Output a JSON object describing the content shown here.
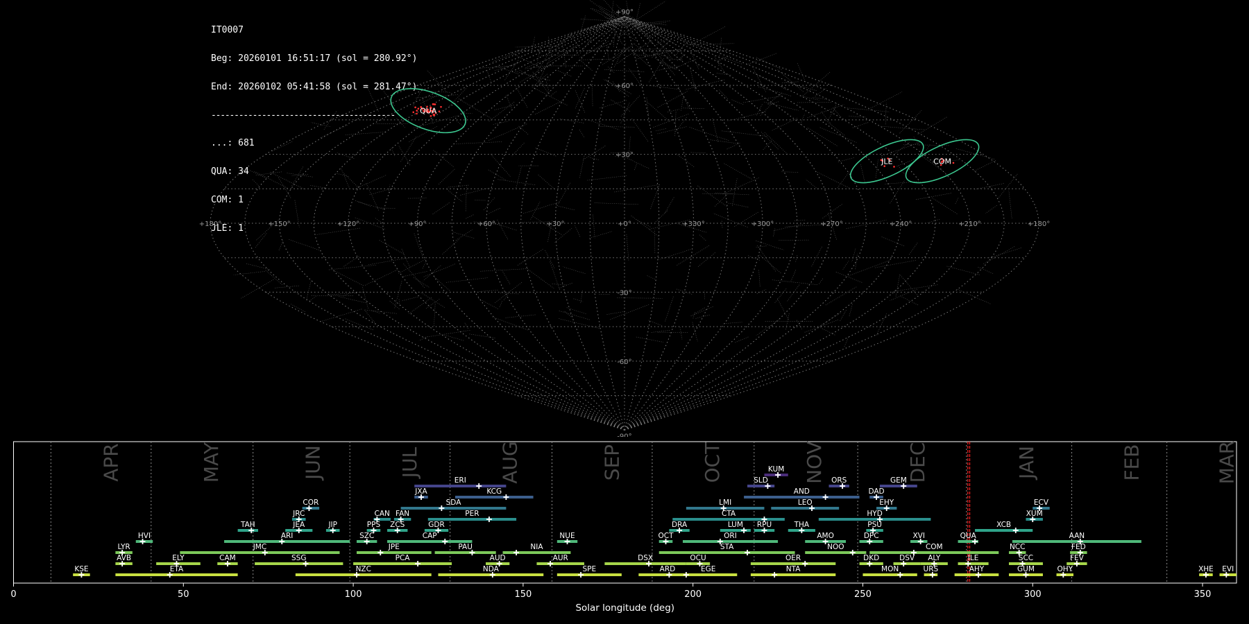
{
  "info": {
    "station": "IT0007",
    "beg": "Beg: 20260101 16:51:17 (sol = 280.92°)",
    "end": "End: 20260102 05:41:58 (sol = 281.47°)",
    "separator": "----------------------------------------",
    "counts": [
      "...: 681",
      "QUA: 34",
      "COM: 1",
      "JLE: 1"
    ]
  },
  "colors": {
    "background": "#000000",
    "grid": "#8a8a8a",
    "meteor_trail": "#6e6e6e",
    "shower_highlight": "#ff3030",
    "radiant_circle": "#3cc890",
    "label": "#ffffff",
    "month": "#4a4a4a"
  },
  "chart_data": [
    {
      "type": "scatter",
      "projection": "sinusoidal",
      "lon_labels": [
        "+180°",
        "+150°",
        "+120°",
        "+90°",
        "+60°",
        "+30°",
        "+0°",
        "+330°",
        "+300°",
        "+270°",
        "+240°",
        "+210°",
        "+180°"
      ],
      "lat_labels": [
        {
          "lat": 90,
          "label": "+90°"
        },
        {
          "lat": 60,
          "label": "+60°"
        },
        {
          "lat": 30,
          "label": "+30°"
        },
        {
          "lat": -30,
          "label": "-30°"
        },
        {
          "lat": -60,
          "label": "-60°"
        },
        {
          "lat": -90,
          "label": "-90°"
        }
      ],
      "radiants": [
        {
          "name": "QUA",
          "lon": 230,
          "lat": 49,
          "radius": 8
        },
        {
          "name": "COM",
          "lon": 155,
          "lat": 27,
          "radius": 6
        },
        {
          "name": "JLE",
          "lon": 128,
          "lat": 27,
          "radius": 6
        }
      ]
    },
    {
      "type": "bar",
      "xlabel": "Solar longitude (deg)",
      "xlim": [
        0,
        360
      ],
      "xticks": [
        0,
        50,
        100,
        150,
        200,
        250,
        300,
        350
      ],
      "current_sol": [
        280.92,
        281.47
      ],
      "months": [
        {
          "name": "APR",
          "start": 11
        },
        {
          "name": "MAY",
          "start": 40.5
        },
        {
          "name": "JUN",
          "start": 70.5
        },
        {
          "name": "JUL",
          "start": 99
        },
        {
          "name": "AUG",
          "start": 128.5
        },
        {
          "name": "SEP",
          "start": 158.5
        },
        {
          "name": "OCT",
          "start": 188
        },
        {
          "name": "NOV",
          "start": 218
        },
        {
          "name": "DEC",
          "start": 248.5
        },
        {
          "name": "JAN",
          "start": 280.5
        },
        {
          "name": "FEB",
          "start": 311.5
        },
        {
          "name": "MAR",
          "start": 339.5
        }
      ],
      "showers": [
        {
          "code": "KSE",
          "start": 17.5,
          "end": 22.5,
          "peak": 20,
          "row": 0
        },
        {
          "code": "ETA",
          "start": 30,
          "end": 66,
          "peak": 46,
          "row": 0
        },
        {
          "code": "NZC",
          "start": 83,
          "end": 123,
          "peak": 101,
          "row": 0
        },
        {
          "code": "NDA",
          "start": 125,
          "end": 156,
          "peak": 141,
          "row": 0
        },
        {
          "code": "SPE",
          "start": 160,
          "end": 179,
          "peak": 167,
          "row": 0
        },
        {
          "code": "ARD",
          "start": 184,
          "end": 201,
          "peak": 193,
          "row": 0
        },
        {
          "code": "EGE",
          "start": 196,
          "end": 213,
          "peak": 198,
          "row": 0
        },
        {
          "code": "NTA",
          "start": 217,
          "end": 242,
          "peak": 224,
          "row": 0
        },
        {
          "code": "MON",
          "start": 250,
          "end": 266,
          "peak": 261,
          "row": 0
        },
        {
          "code": "URS",
          "start": 268,
          "end": 272,
          "peak": 270.5,
          "row": 0
        },
        {
          "code": "AHY",
          "start": 277,
          "end": 290,
          "peak": 284,
          "row": 0
        },
        {
          "code": "GUM",
          "start": 293,
          "end": 303,
          "peak": 298,
          "row": 0
        },
        {
          "code": "OHY",
          "start": 307,
          "end": 312,
          "peak": 309,
          "row": 0
        },
        {
          "code": "XHE",
          "start": 349,
          "end": 353,
          "peak": 351,
          "row": 0
        },
        {
          "code": "EVI",
          "start": 355,
          "end": 360,
          "peak": 357,
          "row": 0
        },
        {
          "code": "AVB",
          "start": 30,
          "end": 35,
          "peak": 32,
          "row": 1
        },
        {
          "code": "ELY",
          "start": 42,
          "end": 55,
          "peak": 48,
          "row": 1
        },
        {
          "code": "CAM",
          "start": 60,
          "end": 66,
          "peak": 63,
          "row": 1
        },
        {
          "code": "SSG",
          "start": 71,
          "end": 97,
          "peak": 86,
          "row": 1
        },
        {
          "code": "PCA",
          "start": 100,
          "end": 129,
          "peak": 119,
          "row": 1
        },
        {
          "code": "AUD",
          "start": 139,
          "end": 146,
          "peak": 143,
          "row": 1
        },
        {
          "code": "AUR",
          "start": 154,
          "end": 168,
          "peak": 158,
          "row": 1
        },
        {
          "code": "DSX",
          "start": 174,
          "end": 198,
          "peak": 187,
          "row": 1
        },
        {
          "code": "OCU",
          "start": 198,
          "end": 205,
          "peak": 202,
          "row": 1
        },
        {
          "code": "OER",
          "start": 217,
          "end": 242,
          "peak": 233,
          "row": 1
        },
        {
          "code": "DKD",
          "start": 249,
          "end": 256,
          "peak": 252,
          "row": 1
        },
        {
          "code": "DSV",
          "start": 259,
          "end": 267,
          "peak": 262,
          "row": 1
        },
        {
          "code": "ALY",
          "start": 267,
          "end": 275,
          "peak": 271,
          "row": 1
        },
        {
          "code": "ILE",
          "start": 278,
          "end": 287,
          "peak": 281,
          "row": 1
        },
        {
          "code": "SCC",
          "start": 293,
          "end": 303,
          "peak": 297,
          "row": 1
        },
        {
          "code": "FEV",
          "start": 310,
          "end": 316,
          "peak": 313,
          "row": 1
        },
        {
          "code": "LYR",
          "start": 30,
          "end": 35,
          "peak": 32,
          "row": 2
        },
        {
          "code": "JMC",
          "start": 49,
          "end": 96,
          "peak": 74,
          "row": 2
        },
        {
          "code": "JPE",
          "start": 101,
          "end": 123,
          "peak": 108,
          "row": 2
        },
        {
          "code": "PAU",
          "start": 124,
          "end": 142,
          "peak": 135,
          "row": 2
        },
        {
          "code": "NIA",
          "start": 144,
          "end": 164,
          "peak": 148,
          "row": 2
        },
        {
          "code": "STA",
          "start": 190,
          "end": 230,
          "peak": 216,
          "row": 2
        },
        {
          "code": "NOO",
          "start": 233,
          "end": 251,
          "peak": 247,
          "row": 2
        },
        {
          "code": "COM",
          "start": 252,
          "end": 290,
          "peak": 265,
          "row": 2
        },
        {
          "code": "NCC",
          "start": 293,
          "end": 298,
          "peak": 296,
          "row": 2
        },
        {
          "code": "FED",
          "start": 311,
          "end": 316,
          "peak": 314,
          "row": 2
        },
        {
          "code": "HVI",
          "start": 36,
          "end": 41,
          "peak": 38,
          "row": 3
        },
        {
          "code": "ARI",
          "start": 62,
          "end": 99,
          "peak": 79,
          "row": 3
        },
        {
          "code": "SZC",
          "start": 101,
          "end": 107,
          "peak": 104,
          "row": 3
        },
        {
          "code": "CAP",
          "start": 110,
          "end": 135,
          "peak": 127,
          "row": 3
        },
        {
          "code": "NUE",
          "start": 160,
          "end": 166,
          "peak": 163,
          "row": 3
        },
        {
          "code": "OCT",
          "start": 190,
          "end": 194,
          "peak": 192,
          "row": 3
        },
        {
          "code": "ORI",
          "start": 197,
          "end": 225,
          "peak": 208,
          "row": 3
        },
        {
          "code": "AMO",
          "start": 233,
          "end": 245,
          "peak": 239,
          "row": 3
        },
        {
          "code": "DPC",
          "start": 249,
          "end": 256,
          "peak": 252,
          "row": 3
        },
        {
          "code": "XVI",
          "start": 264,
          "end": 269,
          "peak": 267,
          "row": 3
        },
        {
          "code": "QUA",
          "start": 278,
          "end": 284,
          "peak": 283,
          "row": 3
        },
        {
          "code": "AAN",
          "start": 294,
          "end": 332,
          "peak": 314,
          "row": 3
        },
        {
          "code": "TAH",
          "start": 66,
          "end": 72,
          "peak": 70,
          "row": 4
        },
        {
          "code": "JEA",
          "start": 80,
          "end": 88,
          "peak": 84,
          "row": 4
        },
        {
          "code": "JIP",
          "start": 92,
          "end": 96,
          "peak": 94,
          "row": 4
        },
        {
          "code": "PPS",
          "start": 104,
          "end": 108,
          "peak": 106,
          "row": 4
        },
        {
          "code": "ZCS",
          "start": 110,
          "end": 116,
          "peak": 113,
          "row": 4
        },
        {
          "code": "GDR",
          "start": 121,
          "end": 128,
          "peak": 125,
          "row": 4
        },
        {
          "code": "DRA",
          "start": 193,
          "end": 199,
          "peak": 196,
          "row": 4
        },
        {
          "code": "LUM",
          "start": 208,
          "end": 217,
          "peak": 215,
          "row": 4
        },
        {
          "code": "RPU",
          "start": 218,
          "end": 224,
          "peak": 221,
          "row": 4
        },
        {
          "code": "THA",
          "start": 228,
          "end": 236,
          "peak": 232,
          "row": 4
        },
        {
          "code": "PSU",
          "start": 251,
          "end": 256,
          "peak": 253,
          "row": 4
        },
        {
          "code": "XCB",
          "start": 283,
          "end": 300,
          "peak": 295,
          "row": 4
        },
        {
          "code": "JRC",
          "start": 82,
          "end": 86,
          "peak": 84,
          "row": 5
        },
        {
          "code": "CAN",
          "start": 106,
          "end": 111,
          "peak": 107,
          "row": 5
        },
        {
          "code": "FAN",
          "start": 112,
          "end": 117,
          "peak": 114,
          "row": 5
        },
        {
          "code": "PER",
          "start": 122,
          "end": 148,
          "peak": 140,
          "row": 5
        },
        {
          "code": "CTA",
          "start": 194,
          "end": 227,
          "peak": 221,
          "row": 5
        },
        {
          "code": "HYD",
          "start": 237,
          "end": 270,
          "peak": 255,
          "row": 5
        },
        {
          "code": "XUM",
          "start": 298,
          "end": 303,
          "peak": 300,
          "row": 5
        },
        {
          "code": "COR",
          "start": 85,
          "end": 90,
          "peak": 87,
          "row": 6
        },
        {
          "code": "SDA",
          "start": 114,
          "end": 145,
          "peak": 126,
          "row": 6
        },
        {
          "code": "LMI",
          "start": 198,
          "end": 221,
          "peak": 209,
          "row": 6
        },
        {
          "code": "LEO",
          "start": 223,
          "end": 243,
          "peak": 235,
          "row": 6
        },
        {
          "code": "EHY",
          "start": 254,
          "end": 260,
          "peak": 257,
          "row": 6
        },
        {
          "code": "ECV",
          "start": 300,
          "end": 305,
          "peak": 302,
          "row": 6
        },
        {
          "code": "JXA",
          "start": 118,
          "end": 122,
          "peak": 120,
          "row": 7
        },
        {
          "code": "KCG",
          "start": 130,
          "end": 153,
          "peak": 145,
          "row": 7
        },
        {
          "code": "AND",
          "start": 215,
          "end": 249,
          "peak": 239,
          "row": 7
        },
        {
          "code": "DAD",
          "start": 252,
          "end": 256,
          "peak": 254,
          "row": 7
        },
        {
          "code": "ERI",
          "start": 118,
          "end": 145,
          "peak": 137,
          "row": 8
        },
        {
          "code": "SLD",
          "start": 216,
          "end": 224,
          "peak": 222,
          "row": 8
        },
        {
          "code": "ORS",
          "start": 240,
          "end": 246,
          "peak": 244,
          "row": 8
        },
        {
          "code": "GEM",
          "start": 255,
          "end": 266,
          "peak": 262,
          "row": 8
        },
        {
          "code": "KUM",
          "start": 221,
          "end": 228,
          "peak": 225,
          "row": 9
        }
      ]
    }
  ]
}
